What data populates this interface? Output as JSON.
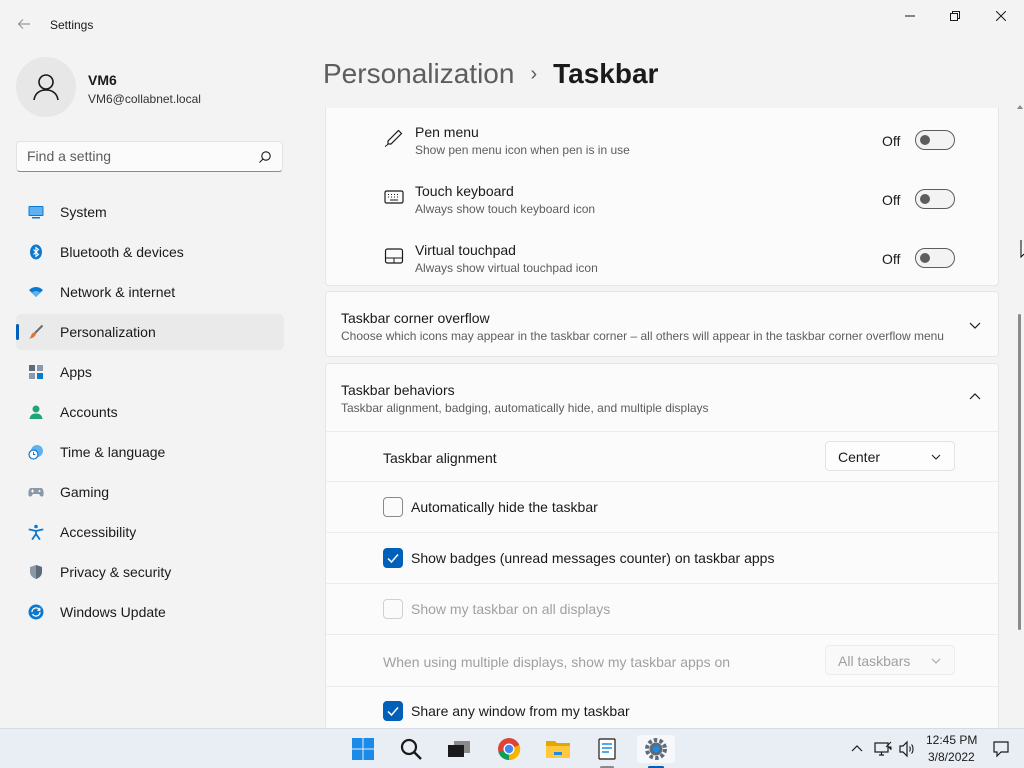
{
  "window": {
    "title": "Settings"
  },
  "profile": {
    "name": "VM6",
    "email": "VM6@collabnet.local"
  },
  "search": {
    "placeholder": "Find a setting"
  },
  "sidebar": {
    "items": [
      {
        "label": "System",
        "icon": "system-icon",
        "active": false
      },
      {
        "label": "Bluetooth & devices",
        "icon": "bluetooth-icon",
        "active": false
      },
      {
        "label": "Network & internet",
        "icon": "wifi-icon",
        "active": false
      },
      {
        "label": "Personalization",
        "icon": "brush-icon",
        "active": true
      },
      {
        "label": "Apps",
        "icon": "apps-icon",
        "active": false
      },
      {
        "label": "Accounts",
        "icon": "accounts-icon",
        "active": false
      },
      {
        "label": "Time & language",
        "icon": "clock-globe-icon",
        "active": false
      },
      {
        "label": "Gaming",
        "icon": "gamepad-icon",
        "active": false
      },
      {
        "label": "Accessibility",
        "icon": "accessibility-icon",
        "active": false
      },
      {
        "label": "Privacy & security",
        "icon": "shield-icon",
        "active": false
      },
      {
        "label": "Windows Update",
        "icon": "update-icon",
        "active": false
      }
    ]
  },
  "breadcrumb": {
    "parent": "Personalization",
    "separator": "›",
    "current": "Taskbar"
  },
  "corner_icons": {
    "items": [
      {
        "title": "Pen menu",
        "subtitle": "Show pen menu icon when pen is in use",
        "state": "Off",
        "icon": "pen-icon"
      },
      {
        "title": "Touch keyboard",
        "subtitle": "Always show touch keyboard icon",
        "state": "Off",
        "icon": "keyboard-icon"
      },
      {
        "title": "Virtual touchpad",
        "subtitle": "Always show virtual touchpad icon",
        "state": "Off",
        "icon": "touchpad-icon"
      }
    ]
  },
  "corner_overflow": {
    "title": "Taskbar corner overflow",
    "subtitle": "Choose which icons may appear in the taskbar corner – all others will appear in the taskbar corner overflow menu"
  },
  "behaviors": {
    "title": "Taskbar behaviors",
    "subtitle": "Taskbar alignment, badging, automatically hide, and multiple displays",
    "alignment_label": "Taskbar alignment",
    "alignment_value": "Center",
    "auto_hide_label": "Automatically hide the taskbar",
    "auto_hide_checked": false,
    "badges_label": "Show badges (unread messages counter) on taskbar apps",
    "badges_checked": true,
    "all_displays_label": "Show my taskbar on all displays",
    "all_displays_checked": false,
    "multi_display_label": "When using multiple displays, show my taskbar apps on",
    "multi_display_value": "All taskbars",
    "share_window_label": "Share any window from my taskbar",
    "share_window_checked": true
  },
  "taskbar": {
    "apps": [
      "start-icon",
      "search-icon",
      "task-view-icon",
      "chrome-icon",
      "file-explorer-icon",
      "notepad-icon",
      "settings-icon"
    ],
    "time": "12:45 PM",
    "date": "3/8/2022"
  },
  "colors": {
    "accent": "#005fb8",
    "background": "#f3f3f3",
    "card": "#fbfbfb"
  }
}
